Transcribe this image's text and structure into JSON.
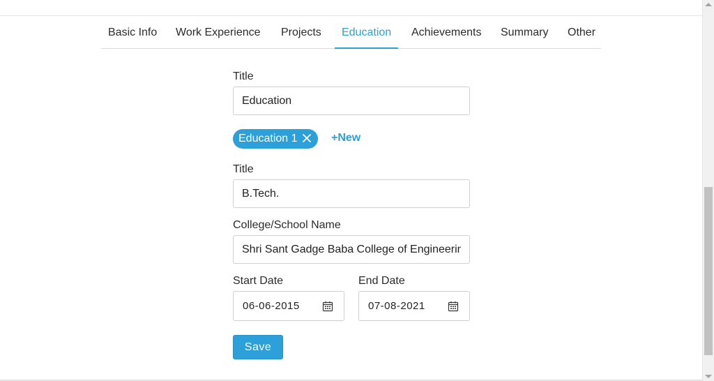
{
  "tabs": [
    {
      "label": "Basic Info"
    },
    {
      "label": "Work Experience"
    },
    {
      "label": "Projects"
    },
    {
      "label": "Education"
    },
    {
      "label": "Achievements"
    },
    {
      "label": "Summary"
    },
    {
      "label": "Other"
    }
  ],
  "active_tab": "Education",
  "section": {
    "title_label": "Title",
    "title_value": "Education"
  },
  "entries": {
    "chip_label": "Education 1",
    "new_label": "+New"
  },
  "entry": {
    "title_label": "Title",
    "title_value": "B.Tech.",
    "college_label": "College/School Name",
    "college_value": "Shri Sant Gadge Baba College of Engineering",
    "start_label": "Start Date",
    "start_value": "06-06-2015",
    "end_label": "End Date",
    "end_value": "07-08-2021"
  },
  "save_label": "Save",
  "colors": {
    "accent": "#2d9fd9"
  }
}
